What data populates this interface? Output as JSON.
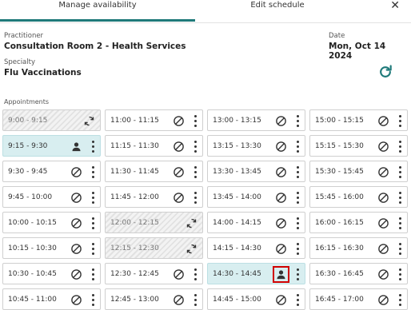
{
  "tabs": [
    {
      "label": "Manage availability",
      "active": true
    },
    {
      "label": "Edit schedule",
      "active": false
    }
  ],
  "close_icon": "close-icon",
  "practitioner": {
    "label": "Practitioner",
    "value": "Consultation Room 2 - Health Services"
  },
  "date": {
    "label": "Date",
    "value": "Mon, Oct 14 2024"
  },
  "specialty": {
    "label": "Specialty",
    "value": "Flu Vaccinations"
  },
  "refresh_icon": "refresh-icon",
  "appointments": {
    "label": "Appointments",
    "columns": [
      [
        {
          "time": "9:00 - 9:15",
          "state": "pending"
        },
        {
          "time": "9:15 - 9:30",
          "state": "booked"
        },
        {
          "time": "9:30 - 9:45",
          "state": "open"
        },
        {
          "time": "9:45 - 10:00",
          "state": "open"
        },
        {
          "time": "10:00 - 10:15",
          "state": "open"
        },
        {
          "time": "10:15 - 10:30",
          "state": "open"
        },
        {
          "time": "10:30 - 10:45",
          "state": "open"
        },
        {
          "time": "10:45 - 11:00",
          "state": "open"
        }
      ],
      [
        {
          "time": "11:00 - 11:15",
          "state": "open"
        },
        {
          "time": "11:15 - 11:30",
          "state": "open"
        },
        {
          "time": "11:30 - 11:45",
          "state": "open"
        },
        {
          "time": "11:45 - 12:00",
          "state": "open"
        },
        {
          "time": "12:00 - 12:15",
          "state": "pending"
        },
        {
          "time": "12:15 - 12:30",
          "state": "pending"
        },
        {
          "time": "12:30 - 12:45",
          "state": "open"
        },
        {
          "time": "12:45 - 13:00",
          "state": "open"
        }
      ],
      [
        {
          "time": "13:00 - 13:15",
          "state": "open"
        },
        {
          "time": "13:15 - 13:30",
          "state": "open"
        },
        {
          "time": "13:30 - 13:45",
          "state": "open"
        },
        {
          "time": "13:45 - 14:00",
          "state": "open"
        },
        {
          "time": "14:00 - 14:15",
          "state": "open"
        },
        {
          "time": "14:15 - 14:30",
          "state": "open"
        },
        {
          "time": "14:30 - 14:45",
          "state": "booked",
          "highlighted": true
        },
        {
          "time": "14:45 - 15:00",
          "state": "open"
        }
      ],
      [
        {
          "time": "15:00 - 15:15",
          "state": "open"
        },
        {
          "time": "15:15 - 15:30",
          "state": "open"
        },
        {
          "time": "15:30 - 15:45",
          "state": "open"
        },
        {
          "time": "15:45 - 16:00",
          "state": "open"
        },
        {
          "time": "16:00 - 16:15",
          "state": "open"
        },
        {
          "time": "16:15 - 16:30",
          "state": "open"
        },
        {
          "time": "16:30 - 16:45",
          "state": "open"
        },
        {
          "time": "16:45 - 17:00",
          "state": "open"
        }
      ]
    ]
  },
  "colors": {
    "accent": "#1f7a7a",
    "booked_bg": "#d8eef0",
    "highlight": "#d00000"
  }
}
